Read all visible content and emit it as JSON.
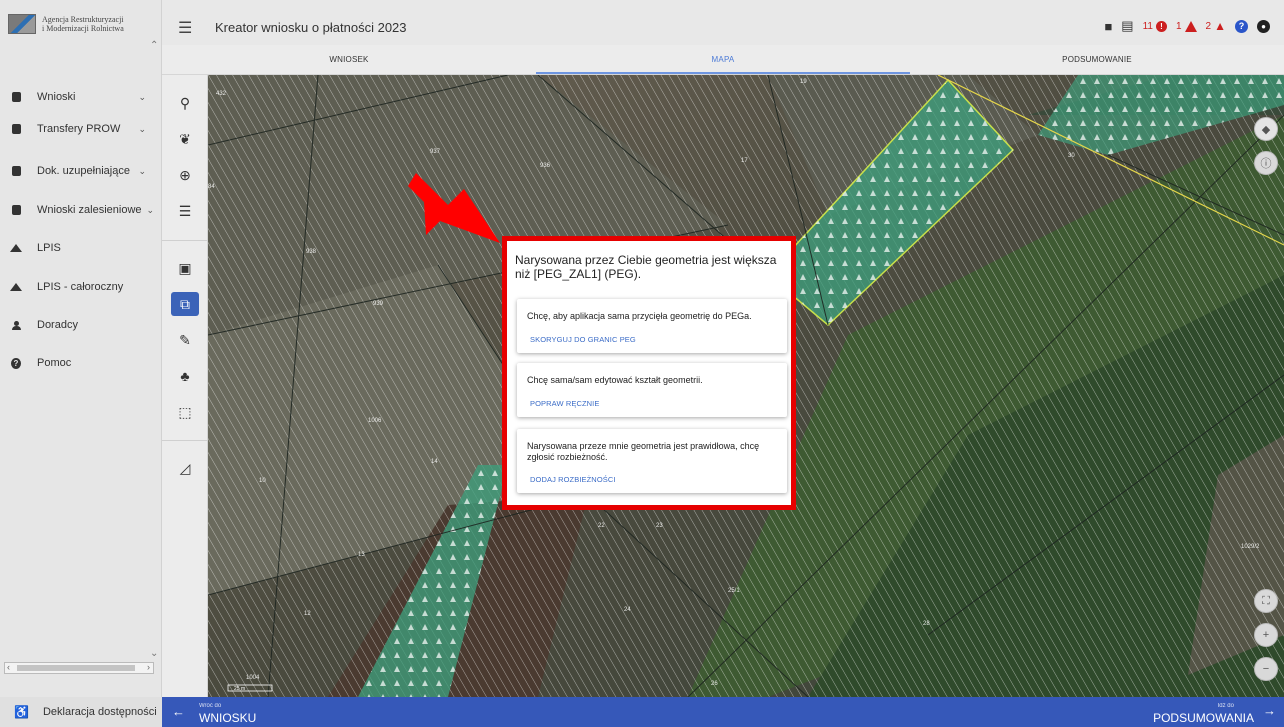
{
  "logo": {
    "line1": "Agencja Restrukturyzacji",
    "line2": "i Modernizacji Rolnictwa"
  },
  "sidebar": {
    "items": [
      {
        "label": "Wnioski",
        "icon": "document-icon",
        "chevron": true
      },
      {
        "label": "Transfery PROW",
        "icon": "document-icon",
        "chevron": true
      },
      {
        "label": "Dok. uzupełniające",
        "icon": "document-icon",
        "chevron": true
      },
      {
        "label": "Wnioski zalesieniowe",
        "icon": "document-icon",
        "chevron": true
      },
      {
        "label": "LPIS",
        "icon": "terrain-icon",
        "chevron": false
      },
      {
        "label": "LPIS - całoroczny",
        "icon": "terrain-icon",
        "chevron": false
      },
      {
        "label": "Doradcy",
        "icon": "person-icon",
        "chevron": false
      },
      {
        "label": "Pomoc",
        "icon": "help-icon",
        "chevron": false
      }
    ],
    "footer_label": "Deklaracja dostępności"
  },
  "header": {
    "title": "Kreator wniosku o płatności 2023",
    "error_count": "11",
    "warning_count": "1",
    "notice_count": "2"
  },
  "tabs": [
    {
      "label": "WNIOSEK",
      "active": false
    },
    {
      "label": "MAPA",
      "active": true
    },
    {
      "label": "PODSUMOWANIE",
      "active": false
    }
  ],
  "map": {
    "parcel_labels": [
      "432",
      "937",
      "936",
      "17",
      "19",
      "30",
      "84",
      "938",
      "939",
      "1006",
      "14",
      "13",
      "12",
      "22",
      "23",
      "24",
      "25/1",
      "26",
      "28",
      "1029/2",
      "1004",
      "10"
    ],
    "scale_label": "25 m"
  },
  "dialog": {
    "title": "Narysowana przez Ciebie geometria jest większa niż [PEG_ZAL1] (PEG).",
    "options": [
      {
        "text": "Chcę, aby aplikacja sama przycięła geometrię do PEGa.",
        "action": "SKORYGUJ DO GRANIC PEG"
      },
      {
        "text": "Chcę sama/sam edytować kształt geometrii.",
        "action": "POPRAW RĘCZNIE"
      },
      {
        "text": "Narysowana przeze mnie geometria jest prawidłowa, chcę zgłosić rozbieżność.",
        "action": "DODAJ ROZBIEŻNOŚCI"
      }
    ]
  },
  "bottom": {
    "back_small": "Wróć do",
    "back_label": "WNIOSKU",
    "next_small": "Idź do",
    "next_label": "PODSUMOWANIA"
  },
  "colors": {
    "accent": "#3658b9",
    "highlight": "#e60000",
    "forest": "#3f9c7a"
  }
}
